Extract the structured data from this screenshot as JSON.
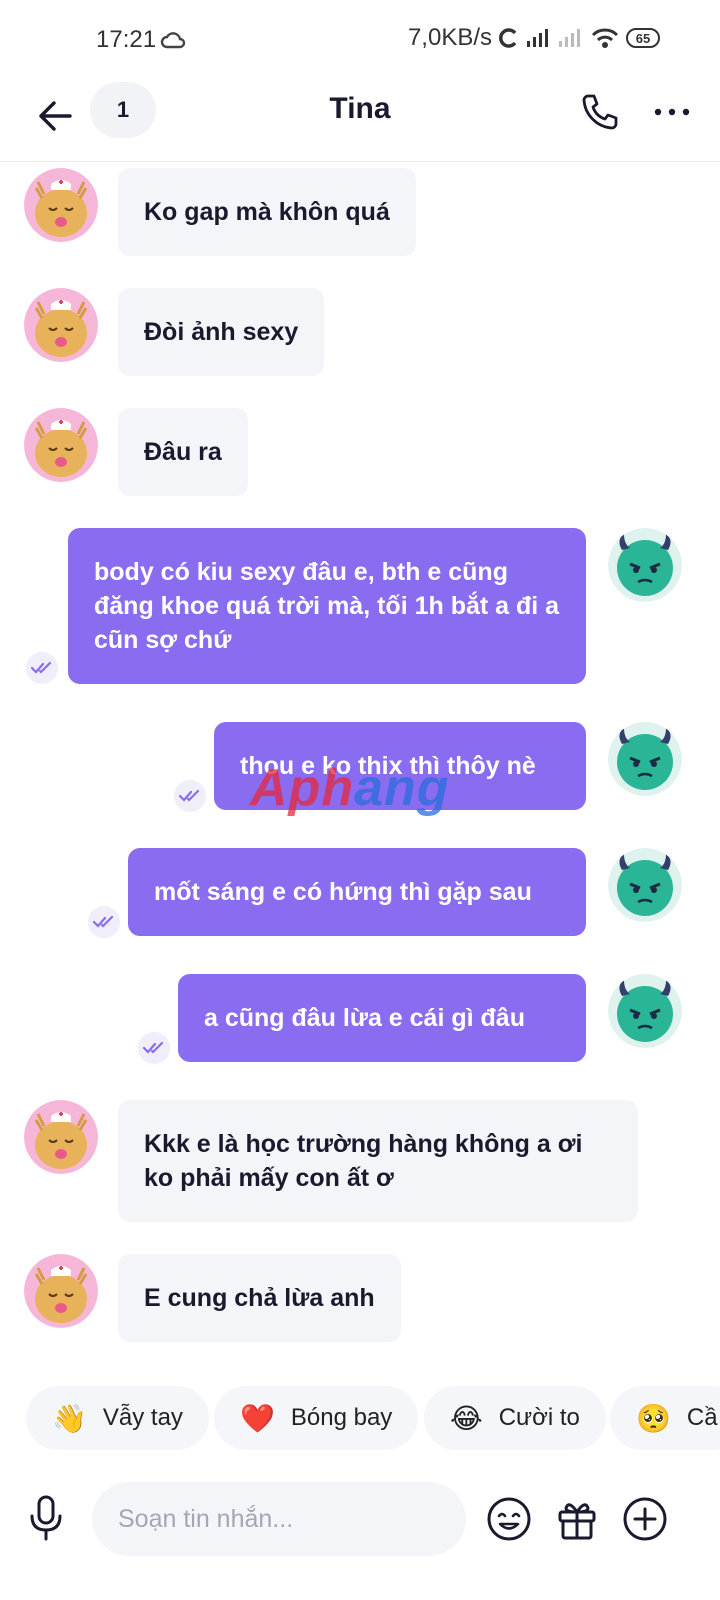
{
  "status": {
    "time": "17:21",
    "net_speed": "7,0KB/s",
    "battery": "65"
  },
  "header": {
    "badge_count": "1",
    "title": "Tina"
  },
  "messages": [
    {
      "from": "in",
      "text": "Ko gap mà khôn quá"
    },
    {
      "from": "in",
      "text": "Đòi ảnh sexy"
    },
    {
      "from": "in",
      "text": "Đâu ra"
    },
    {
      "from": "out",
      "text": "body có kiu sexy đâu e, bth e cũng đăng khoe quá trời mà, tối 1h bắt a đi a cũn sợ chứ"
    },
    {
      "from": "out",
      "text": "thou e ko thix thì thôy nè"
    },
    {
      "from": "out",
      "text": "mốt sáng e có hứng thì gặp sau"
    },
    {
      "from": "out",
      "text": "a cũng đâu lừa  e cái gì đâu"
    },
    {
      "from": "in",
      "text": "Kkk e là học trường hàng không a ơi ko phải mấy con ất ơ"
    },
    {
      "from": "in",
      "text": "E cung chả lừa anh"
    }
  ],
  "watermark": {
    "part1": "Aph",
    "part2": "ang"
  },
  "reactions": [
    {
      "emoji": "👋",
      "label": "Vẫy tay"
    },
    {
      "emoji": "❤️",
      "label": "Bóng bay"
    },
    {
      "emoji": "😂",
      "label": "Cười to"
    },
    {
      "emoji": "🥺",
      "label": "Cầ"
    }
  ],
  "composer": {
    "placeholder": "Soạn tin nhắn..."
  },
  "colors": {
    "outgoing_bubble": "#8a6cf0",
    "incoming_bubble": "#f4f5f8",
    "tina_avatar_bg": "#f6b6d8",
    "me_avatar_bg": "#dff2ee"
  }
}
